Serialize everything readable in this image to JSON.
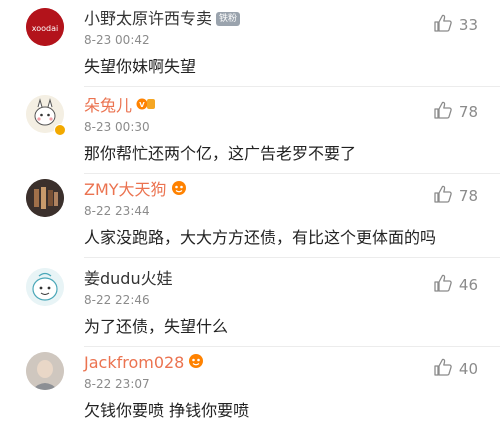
{
  "comments": [
    {
      "name": "小野太原许西专卖",
      "tag": "铁粉",
      "time": "8-23 00:42",
      "text": "失望你妹啊失望",
      "likes": "33",
      "avatar": "avatar-red-logo",
      "name_color": "#333333"
    },
    {
      "name": "朵兔儿",
      "time": "8-23 00:30",
      "text": "那你帮忙还两个亿，这广告老罗不要了",
      "likes": "78",
      "avatar": "avatar-cartoon",
      "name_color": "#eb7350"
    },
    {
      "name": "ZMY大天狗",
      "time": "8-22 23:44",
      "text": "人家没跑路，大大方方还债，有比这个更体面的吗",
      "likes": "78",
      "avatar": "avatar-dark-photo",
      "name_color": "#eb7350"
    },
    {
      "name": "姜dudu火娃",
      "time": "8-22 22:46",
      "text": "为了还债，失望什么",
      "likes": "46",
      "avatar": "avatar-cartoon-face",
      "name_color": "#333333"
    },
    {
      "name": "Jackfrom028",
      "time": "8-22 23:07",
      "text": "欠钱你要喷 挣钱你要喷",
      "likes": "40",
      "avatar": "avatar-photo",
      "name_color": "#eb7350"
    }
  ]
}
